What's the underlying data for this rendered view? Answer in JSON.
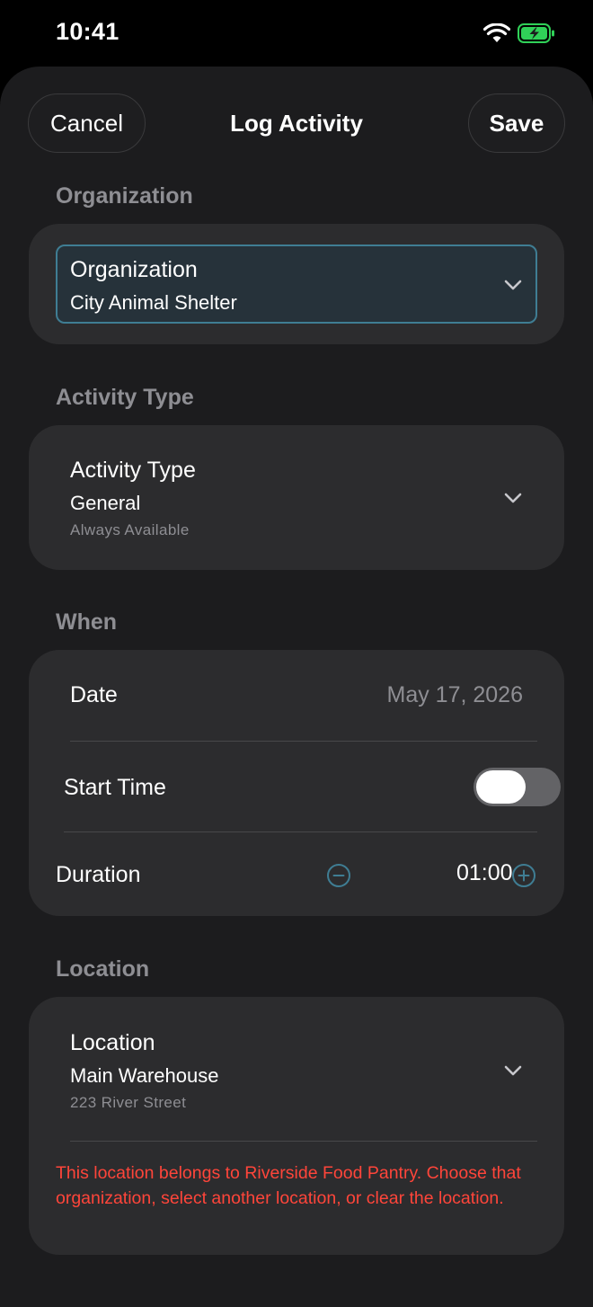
{
  "status_bar": {
    "time": "10:41",
    "icons": [
      "wifi-icon",
      "battery-charging-icon"
    ],
    "battery_color": "#30d158"
  },
  "nav": {
    "cancel_label": "Cancel",
    "title": "Log Activity",
    "save_label": "Save"
  },
  "organization": {
    "section_title": "Organization",
    "field_label": "Organization",
    "value": "City Animal Shelter",
    "focus_color": "#3f7d93"
  },
  "activity_type": {
    "section_title": "Activity Type",
    "field_label": "Activity Type",
    "value": "General",
    "subtitle": "Always Available"
  },
  "when": {
    "section_title": "When",
    "date_label": "Date",
    "date_value": "May 17, 2026",
    "start_time_label": "Start Time",
    "start_time_enabled": false,
    "duration_label": "Duration",
    "duration_value": "01:00",
    "stepper_color": "#3f7d93"
  },
  "location": {
    "section_title": "Location",
    "field_label": "Location",
    "value": "Main Warehouse",
    "address": "223 River Street",
    "warning": "This location belongs to Riverside Food Pantry. Choose that organization, select another location, or clear the location.",
    "warning_color": "#ff453a"
  }
}
